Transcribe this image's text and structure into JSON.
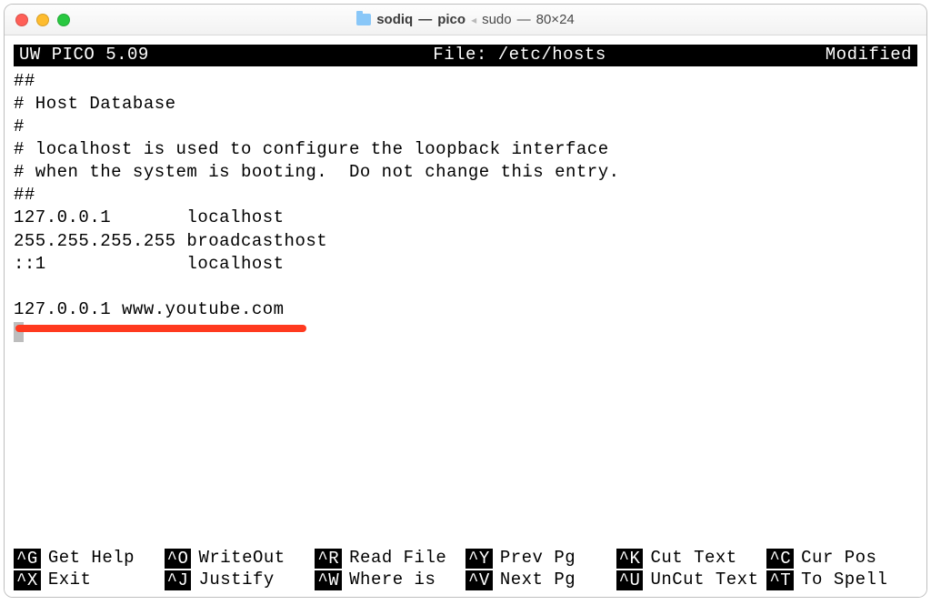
{
  "window": {
    "title_folder": "sodiq",
    "title_app": "pico",
    "title_cmd": "sudo",
    "title_size": "80×24"
  },
  "status": {
    "left": "UW PICO 5.09",
    "center_label": "File:",
    "center_value": "/etc/hosts",
    "right": "Modified"
  },
  "file_lines": [
    "##",
    "# Host Database",
    "#",
    "# localhost is used to configure the loopback interface",
    "# when the system is booting.  Do not change this entry.",
    "##",
    "127.0.0.1       localhost",
    "255.255.255.255 broadcasthost",
    "::1             localhost",
    "",
    "127.0.0.1 www.youtube.com"
  ],
  "shortcuts": [
    {
      "key": "^G",
      "label": "Get Help"
    },
    {
      "key": "^O",
      "label": "WriteOut"
    },
    {
      "key": "^R",
      "label": "Read File"
    },
    {
      "key": "^Y",
      "label": "Prev Pg"
    },
    {
      "key": "^K",
      "label": "Cut Text"
    },
    {
      "key": "^C",
      "label": "Cur Pos"
    },
    {
      "key": "^X",
      "label": "Exit"
    },
    {
      "key": "^J",
      "label": "Justify"
    },
    {
      "key": "^W",
      "label": "Where is"
    },
    {
      "key": "^V",
      "label": "Next Pg"
    },
    {
      "key": "^U",
      "label": "UnCut Text"
    },
    {
      "key": "^T",
      "label": "To Spell"
    }
  ],
  "annotation_color": "#ff3a1f"
}
